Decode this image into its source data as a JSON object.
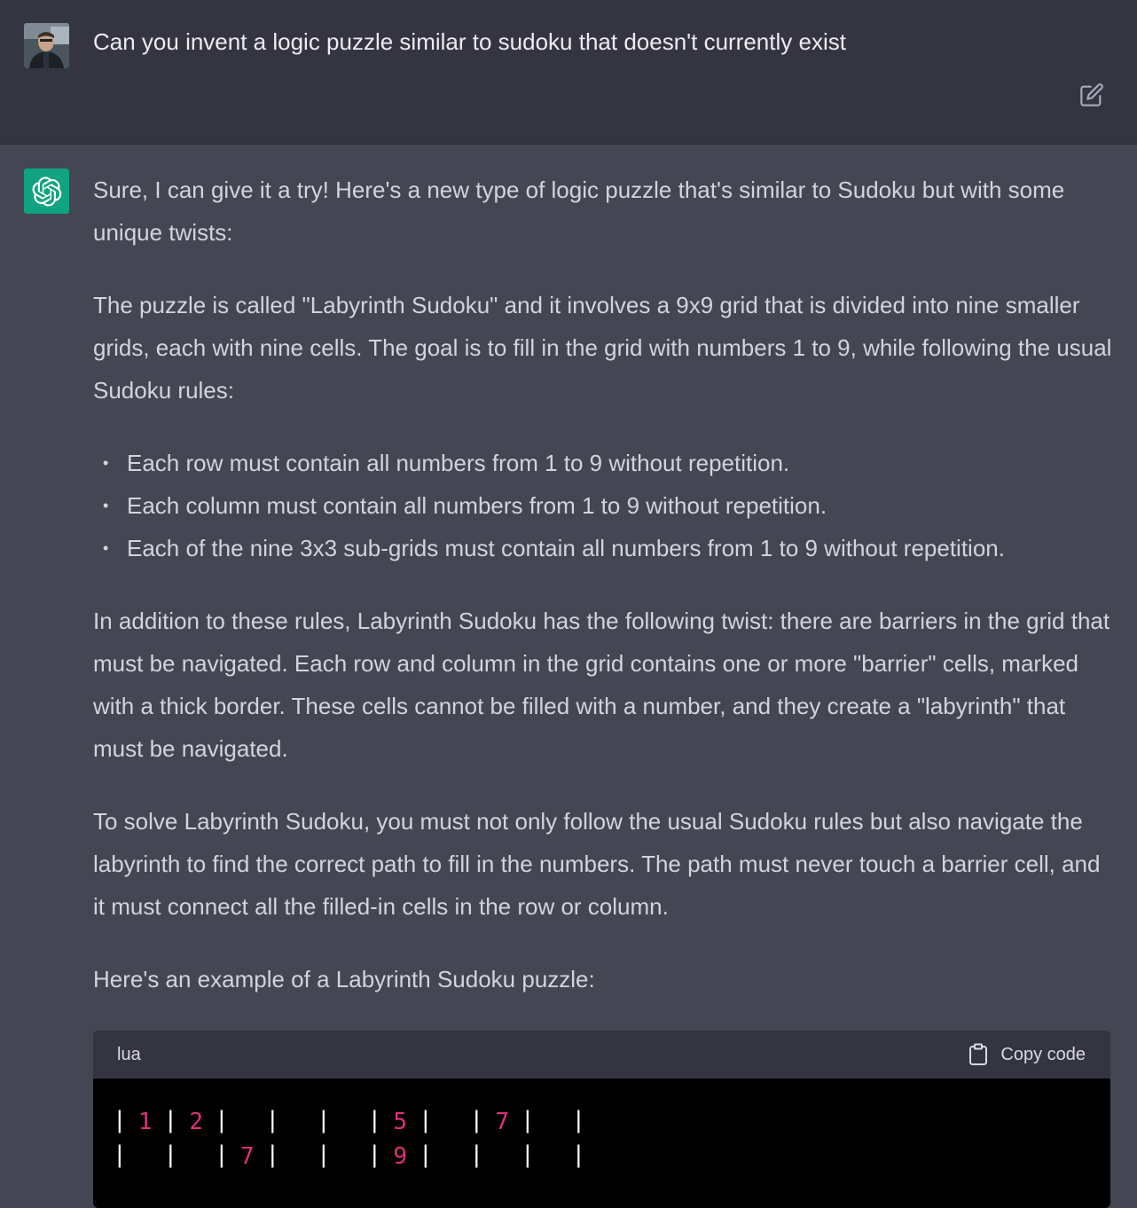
{
  "user_message": {
    "text": "Can you invent a logic puzzle similar to sudoku that doesn't currently exist"
  },
  "assistant_message": {
    "intro": "Sure, I can give it a try! Here's a new type of logic puzzle that's similar to Sudoku but with some unique twists:",
    "description": "The puzzle is called \"Labyrinth Sudoku\" and it involves a 9x9 grid that is divided into nine smaller grids, each with nine cells. The goal is to fill in the grid with numbers 1 to 9, while following the usual Sudoku rules:",
    "rules": [
      "Each row must contain all numbers from 1 to 9 without repetition.",
      "Each column must contain all numbers from 1 to 9 without repetition.",
      "Each of the nine 3x3 sub-grids must contain all numbers from 1 to 9 without repetition."
    ],
    "twist": "In addition to these rules, Labyrinth Sudoku has the following twist: there are barriers in the grid that must be navigated. Each row and column in the grid contains one or more \"barrier\" cells, marked with a thick border. These cells cannot be filled with a number, and they create a \"labyrinth\" that must be navigated.",
    "solve": "To solve Labyrinth Sudoku, you must not only follow the usual Sudoku rules but also navigate the labyrinth to find the correct path to fill in the numbers. The path must never touch a barrier cell, and it must connect all the filled-in cells in the row or column.",
    "example_intro": "Here's an example of a Labyrinth Sudoku puzzle:"
  },
  "code_block": {
    "language": "lua",
    "copy_label": "Copy code",
    "rows": [
      [
        "1",
        "2",
        "",
        "",
        "",
        "5",
        "",
        "7",
        ""
      ],
      [
        "",
        "",
        "7",
        "",
        "",
        "9",
        "",
        "",
        ""
      ]
    ]
  },
  "icons": {
    "user_avatar": "user-photo-avatar",
    "assistant_avatar": "openai-logo-icon",
    "edit": "edit-icon",
    "copy": "clipboard-icon"
  },
  "colors": {
    "user_bg": "#343541",
    "assistant_bg": "#444654",
    "avatar_green": "#10a37f",
    "code_number": "#df3079"
  }
}
